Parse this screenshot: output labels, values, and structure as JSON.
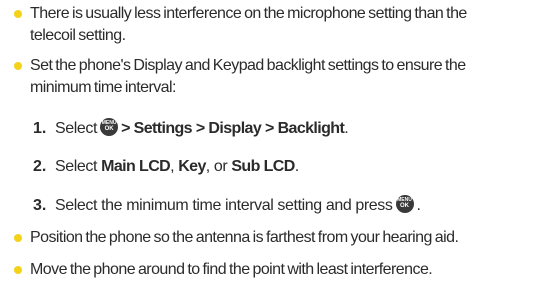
{
  "colors": {
    "bullet": "#f5d21a",
    "text": "#2b2b2b",
    "menu_icon_bg": "#3a3a3a"
  },
  "bullets": [
    {
      "lines": [
        "There is usually less interference on the microphone setting than the",
        "telecoil setting."
      ]
    },
    {
      "lines": [
        "Set the phone's Display and Keypad backlight settings to ensure the",
        "minimum time interval:"
      ]
    },
    {
      "lines": [
        "Position the phone so the antenna is farthest from your hearing aid."
      ]
    },
    {
      "lines": [
        "Move the phone around to find the point with least interference."
      ]
    }
  ],
  "steps": [
    {
      "number": "1.",
      "prefix": "Select",
      "path": "> Settings > Display > Backlight",
      "end": "."
    },
    {
      "number": "2.",
      "prefix": "Select",
      "opt1": "Main LCD",
      "sep1": ", ",
      "opt2": "Key",
      "sep2": ", or ",
      "opt3": "Sub LCD",
      "end": "."
    },
    {
      "number": "3.",
      "text": "Select the minimum time interval setting and press",
      "end": "."
    }
  ],
  "menu_icon": {
    "icon": "menu-ok-key-icon",
    "top_label": "MENU",
    "bottom_label": "OK"
  }
}
